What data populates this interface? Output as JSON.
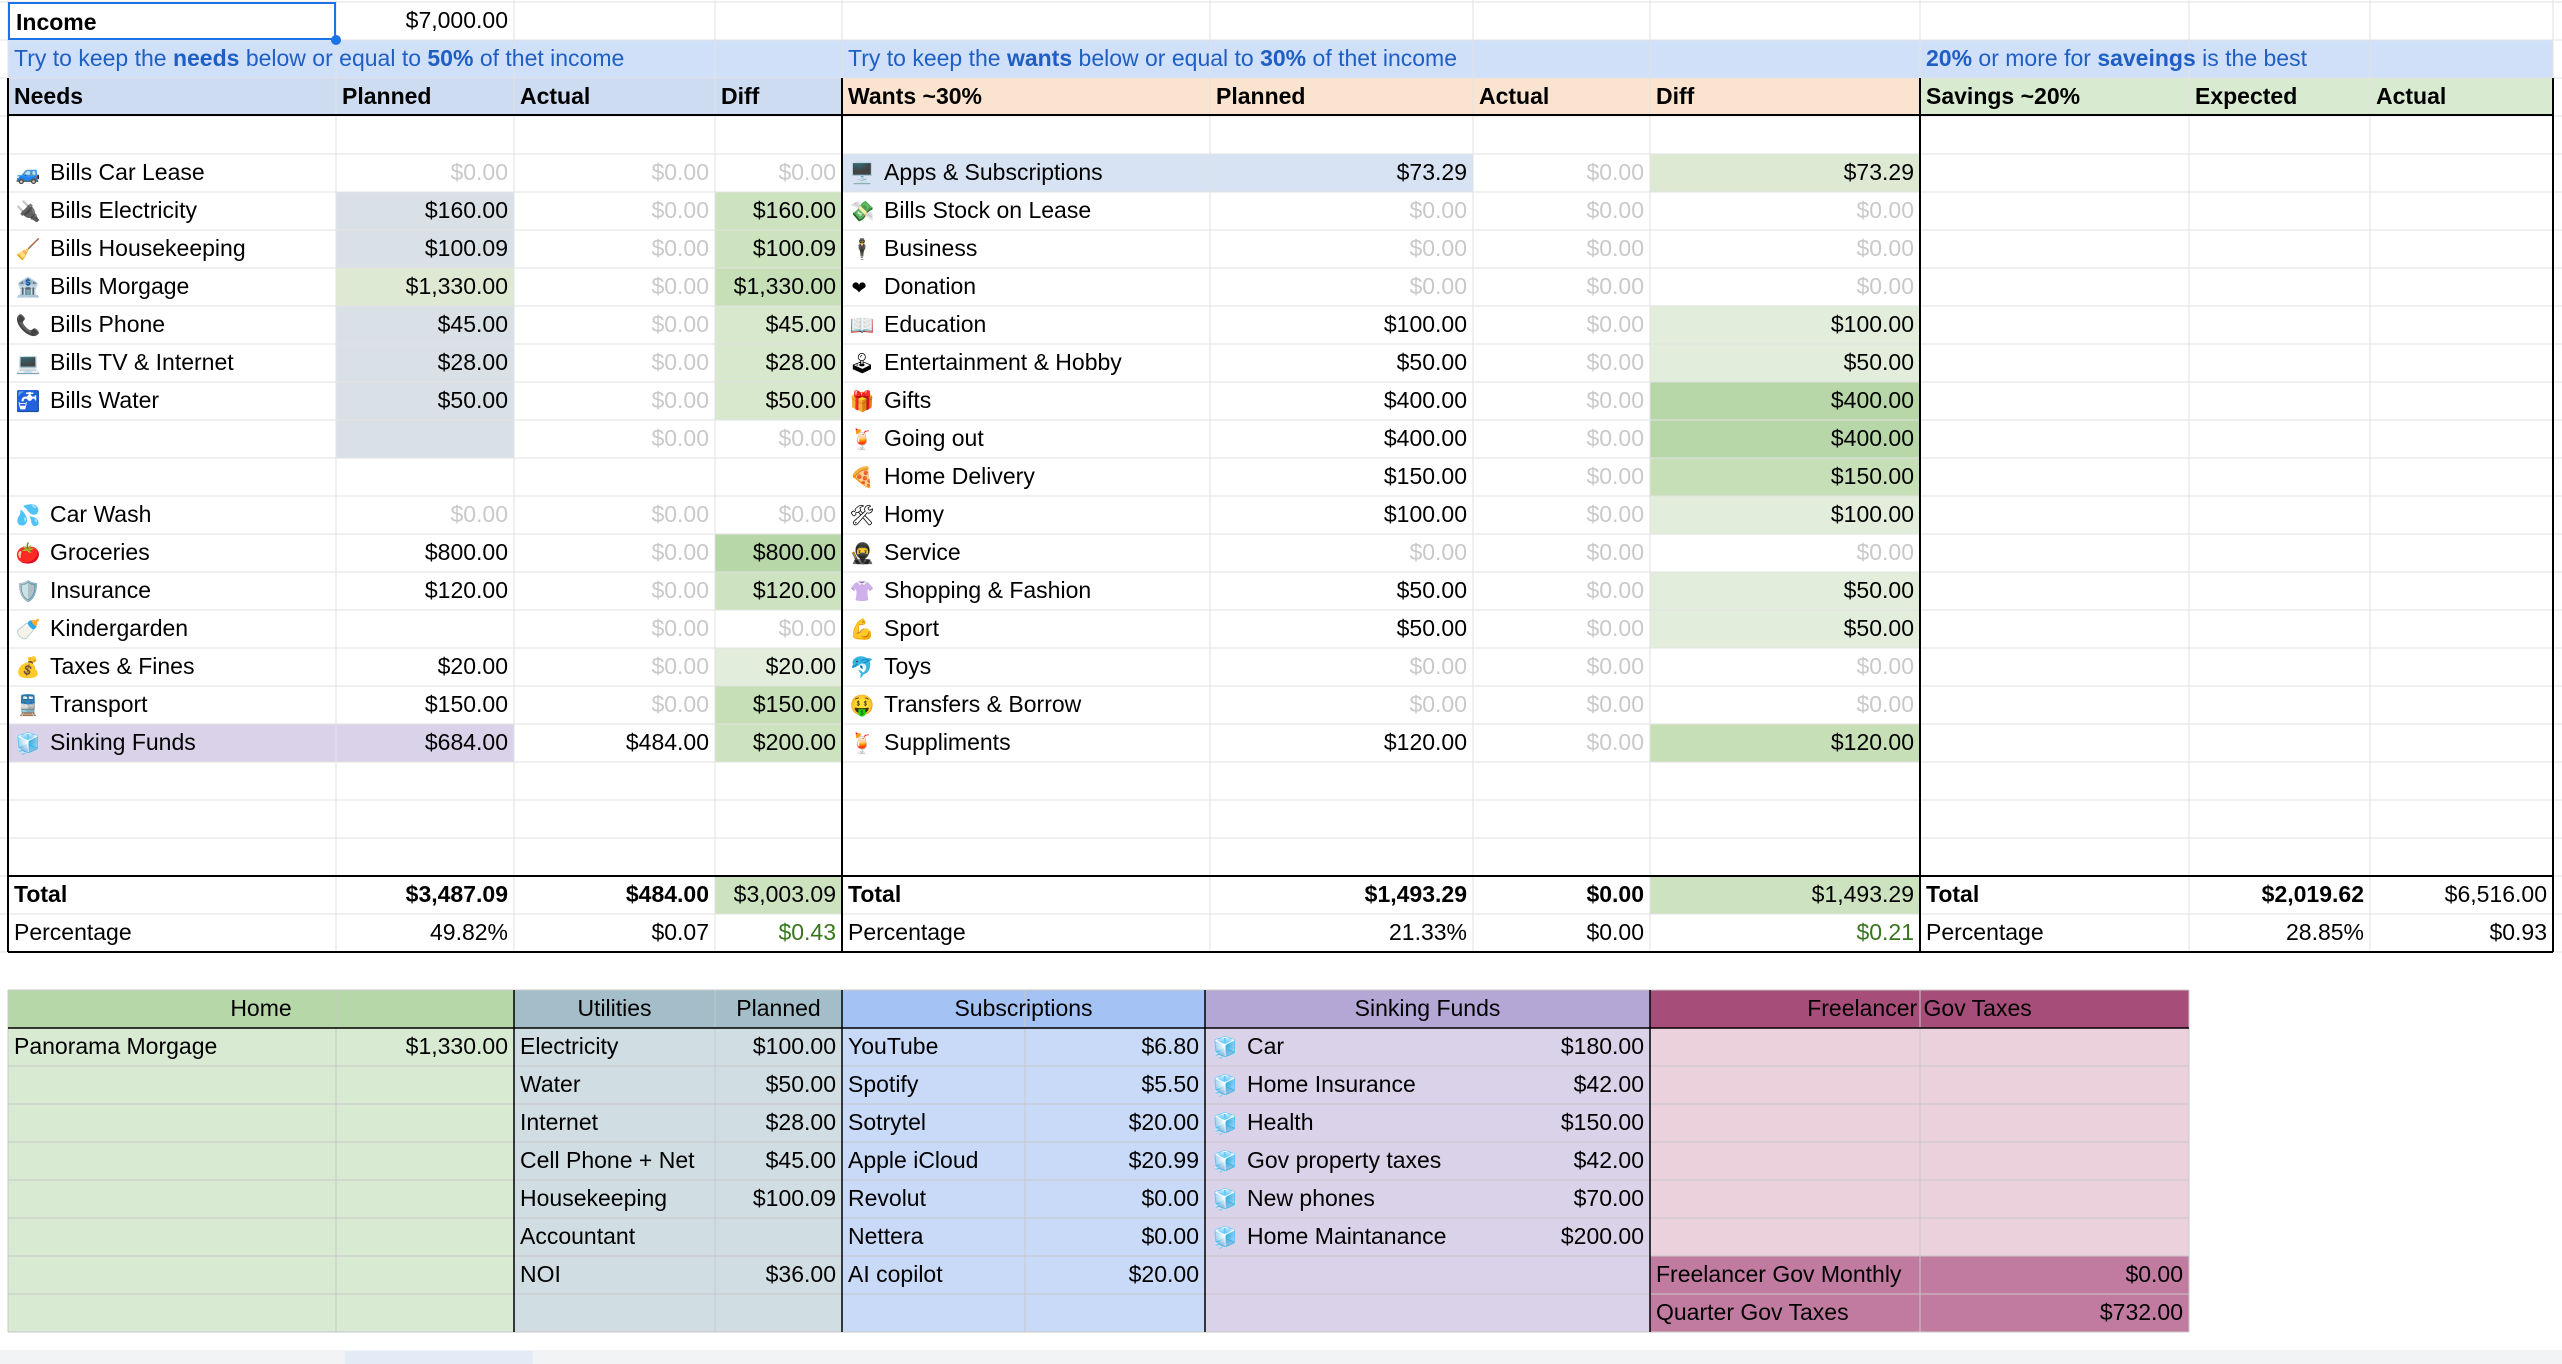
{
  "income": {
    "label": "Income",
    "value": "$7,000.00"
  },
  "notes": [
    {
      "parts": [
        [
          "Try to keep the ",
          0
        ],
        [
          "needs",
          1
        ],
        [
          " below or equal to ",
          0
        ],
        [
          "50%",
          1
        ],
        [
          " of thet income",
          0
        ]
      ]
    },
    {
      "parts": [
        [
          "Try to keep the ",
          0
        ],
        [
          "wants",
          1
        ],
        [
          " below or equal to ",
          0
        ],
        [
          "30%",
          1
        ],
        [
          " of thet income",
          0
        ]
      ]
    },
    {
      "parts": [
        [
          "20%",
          1
        ],
        [
          " or more for ",
          0
        ],
        [
          "saveings",
          1
        ],
        [
          " is the best",
          0
        ]
      ]
    }
  ],
  "headers": {
    "needs": [
      "Needs",
      "Planned",
      "Actual",
      "Diff"
    ],
    "wants": [
      "Wants ~30%",
      "Planned",
      "Actual",
      "Diff"
    ],
    "savings": [
      "Savings ~20%",
      "Expected",
      "Actual"
    ]
  },
  "needs": [
    {
      "icon": "🚙",
      "icon_name": "car-icon",
      "name": "Bills Car Lease",
      "planned": "$0.00",
      "actual": "$0.00",
      "diff": "$0.00",
      "pg": 1,
      "dg": 1,
      "pbg": "",
      "dbg": ""
    },
    {
      "icon": "🔌",
      "icon_name": "plug-icon",
      "name": "Bills Electricity",
      "planned": "$160.00",
      "actual": "$0.00",
      "diff": "$160.00",
      "pg": 0,
      "dg": 0,
      "pbg": "#d9e1e6",
      "dbg": "#cde3c0"
    },
    {
      "icon": "🧹",
      "icon_name": "broom-icon",
      "name": "Bills Housekeeping",
      "planned": "$100.09",
      "actual": "$0.00",
      "diff": "$100.09",
      "pg": 0,
      "dg": 0,
      "pbg": "#d9e1e6",
      "dbg": "#cde3c0"
    },
    {
      "icon": "🏦",
      "icon_name": "bank-icon",
      "name": "Bills Morgage",
      "planned": "$1,330.00",
      "actual": "$0.00",
      "diff": "$1,330.00",
      "pg": 0,
      "dg": 0,
      "pbg": "#dde9d3",
      "dbg": "#c7dfb6"
    },
    {
      "icon": "📞",
      "icon_name": "phone-icon",
      "name": "Bills Phone",
      "planned": "$45.00",
      "actual": "$0.00",
      "diff": "$45.00",
      "pg": 0,
      "dg": 0,
      "pbg": "#d9e1e6",
      "dbg": "#d8e8cd"
    },
    {
      "icon": "💻",
      "icon_name": "laptop-icon",
      "name": "Bills TV & Internet",
      "planned": "$28.00",
      "actual": "$0.00",
      "diff": "$28.00",
      "pg": 0,
      "dg": 0,
      "pbg": "#d9e1e6",
      "dbg": "#d8e8cd"
    },
    {
      "icon": "🚰",
      "icon_name": "water-tap-icon",
      "name": "Bills Water",
      "planned": "$50.00",
      "actual": "$0.00",
      "diff": "$50.00",
      "pg": 0,
      "dg": 0,
      "pbg": "#d9e1e6",
      "dbg": "#d8e8cd"
    },
    {
      "icon": "",
      "icon_name": "",
      "name": "",
      "planned": "",
      "actual": "$0.00",
      "diff": "$0.00",
      "pg": 0,
      "dg": 1,
      "pbg": "#d9e1e6",
      "dbg": ""
    },
    {
      "icon": "",
      "icon_name": "",
      "name": "",
      "planned": "",
      "actual": "",
      "diff": "",
      "pg": 0,
      "dg": 0,
      "pbg": "",
      "dbg": ""
    },
    {
      "icon": "💦",
      "icon_name": "water-drops-icon",
      "name": "Car Wash",
      "planned": "$0.00",
      "actual": "$0.00",
      "diff": "$0.00",
      "pg": 1,
      "dg": 1,
      "pbg": "",
      "dbg": ""
    },
    {
      "icon": "🍅",
      "icon_name": "tomato-icon",
      "name": "Groceries",
      "planned": "$800.00",
      "actual": "$0.00",
      "diff": "$800.00",
      "pg": 0,
      "dg": 0,
      "pbg": "",
      "dbg": "#b7d7a8"
    },
    {
      "icon": "🛡️",
      "icon_name": "shield-icon",
      "name": "Insurance",
      "planned": "$120.00",
      "actual": "$0.00",
      "diff": "$120.00",
      "pg": 0,
      "dg": 0,
      "pbg": "",
      "dbg": "#cde3c0"
    },
    {
      "icon": "🍼",
      "icon_name": "baby-bottle-icon",
      "name": "Kindergarden",
      "planned": "",
      "actual": "$0.00",
      "diff": "$0.00",
      "pg": 0,
      "dg": 1,
      "pbg": "",
      "dbg": ""
    },
    {
      "icon": "💰",
      "icon_name": "money-bag-icon",
      "name": "Taxes & Fines",
      "planned": "$20.00",
      "actual": "$0.00",
      "diff": "$20.00",
      "pg": 0,
      "dg": 0,
      "pbg": "",
      "dbg": "#e2eedb"
    },
    {
      "icon": "🚆",
      "icon_name": "train-icon",
      "name": "Transport",
      "planned": "$150.00",
      "actual": "$0.00",
      "diff": "$150.00",
      "pg": 0,
      "dg": 0,
      "pbg": "",
      "dbg": "#c7dfb6"
    },
    {
      "icon": "🧊",
      "icon_name": "ice-cube-icon",
      "name": "Sinking Funds",
      "planned": "$684.00",
      "actual": "$484.00",
      "diff": "$200.00",
      "pg": 0,
      "dg": 0,
      "pbg": "#d9d2e9",
      "dbg": "#cde3c0",
      "nbg": "#d9d2e9"
    }
  ],
  "wants": [
    {
      "icon": "🖥️",
      "icon_name": "desktop-computer-icon",
      "name": "Apps & Subscriptions",
      "planned": "$73.29",
      "actual": "$0.00",
      "diff": "$73.29",
      "pg": 0,
      "dg": 0,
      "nbg": "#d7e3f2",
      "pbg": "#d7e3f2",
      "dbg": "#dde9d3"
    },
    {
      "icon": "💸",
      "icon_name": "money-wings-icon",
      "name": "Bills Stock on Lease",
      "planned": "$0.00",
      "actual": "$0.00",
      "diff": "$0.00",
      "pg": 1,
      "dg": 1,
      "nbg": "",
      "pbg": "",
      "dbg": ""
    },
    {
      "icon": "🕴",
      "icon_name": "business-person-icon",
      "name": "Business",
      "planned": "$0.00",
      "actual": "$0.00",
      "diff": "$0.00",
      "pg": 1,
      "dg": 1,
      "nbg": "",
      "pbg": "",
      "dbg": ""
    },
    {
      "icon": "❤",
      "icon_name": "heart-icon",
      "name": "Donation",
      "planned": "$0.00",
      "actual": "$0.00",
      "diff": "$0.00",
      "pg": 1,
      "dg": 1,
      "nbg": "",
      "pbg": "",
      "dbg": "",
      "sm": 1
    },
    {
      "icon": "📖",
      "icon_name": "book-icon",
      "name": "Education",
      "planned": "$100.00",
      "actual": "$0.00",
      "diff": "$100.00",
      "pg": 0,
      "dg": 0,
      "nbg": "",
      "pbg": "",
      "dbg": "#e2eedb"
    },
    {
      "icon": "🕹",
      "icon_name": "joystick-icon",
      "name": "Entertainment & Hobby",
      "planned": "$50.00",
      "actual": "$0.00",
      "diff": "$50.00",
      "pg": 0,
      "dg": 0,
      "nbg": "",
      "pbg": "",
      "dbg": "#e2eedb"
    },
    {
      "icon": "🎁",
      "icon_name": "gift-icon",
      "name": "Gifts",
      "planned": "$400.00",
      "actual": "$0.00",
      "diff": "$400.00",
      "pg": 0,
      "dg": 0,
      "nbg": "",
      "pbg": "",
      "dbg": "#b7d7a8"
    },
    {
      "icon": "🍹",
      "icon_name": "drink-icon",
      "name": "Going out",
      "planned": "$400.00",
      "actual": "$0.00",
      "diff": "$400.00",
      "pg": 0,
      "dg": 0,
      "nbg": "",
      "pbg": "",
      "dbg": "#b7d7a8"
    },
    {
      "icon": "🍕",
      "icon_name": "pizza-icon",
      "name": "Home Delivery",
      "planned": "$150.00",
      "actual": "$0.00",
      "diff": "$150.00",
      "pg": 0,
      "dg": 0,
      "nbg": "",
      "pbg": "",
      "dbg": "#c7dfb6"
    },
    {
      "icon": "🛠",
      "icon_name": "tools-icon",
      "name": "Homy",
      "planned": "$100.00",
      "actual": "$0.00",
      "diff": "$100.00",
      "pg": 0,
      "dg": 0,
      "nbg": "",
      "pbg": "",
      "dbg": "#e2eedb"
    },
    {
      "icon": "🥷",
      "icon_name": "ninja-icon",
      "name": "Service",
      "planned": "$0.00",
      "actual": "$0.00",
      "diff": "$0.00",
      "pg": 1,
      "dg": 1,
      "nbg": "",
      "pbg": "",
      "dbg": ""
    },
    {
      "icon": "👚",
      "icon_name": "blouse-icon",
      "name": "Shopping & Fashion",
      "planned": "$50.00",
      "actual": "$0.00",
      "diff": "$50.00",
      "pg": 0,
      "dg": 0,
      "nbg": "",
      "pbg": "",
      "dbg": "#e2eedb"
    },
    {
      "icon": "💪",
      "icon_name": "flexed-biceps-icon",
      "name": "Sport",
      "planned": "$50.00",
      "actual": "$0.00",
      "diff": "$50.00",
      "pg": 0,
      "dg": 0,
      "nbg": "",
      "pbg": "",
      "dbg": "#e2eedb"
    },
    {
      "icon": "🐬",
      "icon_name": "dolphin-icon",
      "name": "Toys",
      "planned": "$0.00",
      "actual": "$0.00",
      "diff": "$0.00",
      "pg": 1,
      "dg": 1,
      "nbg": "",
      "pbg": "",
      "dbg": ""
    },
    {
      "icon": "🤑",
      "icon_name": "money-face-icon",
      "name": "Transfers & Borrow",
      "planned": "$0.00",
      "actual": "$0.00",
      "diff": "$0.00",
      "pg": 1,
      "dg": 1,
      "nbg": "",
      "pbg": "",
      "dbg": ""
    },
    {
      "icon": "🍹",
      "icon_name": "drink-icon",
      "name": "Suppliments",
      "planned": "$120.00",
      "actual": "$0.00",
      "diff": "$120.00",
      "pg": 0,
      "dg": 0,
      "nbg": "",
      "pbg": "",
      "dbg": "#c7dfb6"
    }
  ],
  "totals": {
    "needs": {
      "label": "Total",
      "planned": "$3,487.09",
      "actual": "$484.00",
      "diff": "$3,003.09"
    },
    "wants": {
      "label": "Total",
      "planned": "$1,493.29",
      "actual": "$0.00",
      "diff": "$1,493.29"
    },
    "savings": {
      "label": "Total",
      "expected": "$2,019.62",
      "actual": "$6,516.00"
    }
  },
  "percent": {
    "needs": {
      "label": "Percentage",
      "planned": "49.82%",
      "actual": "$0.07",
      "diff": "$0.43"
    },
    "wants": {
      "label": "Percentage",
      "planned": "21.33%",
      "actual": "$0.00",
      "diff": "$0.21"
    },
    "savings": {
      "label": "Percentage",
      "expected": "28.85%",
      "actual": "$0.93"
    }
  },
  "bottom": {
    "home": {
      "title": "Home",
      "rows": [
        [
          "Panorama Morgage",
          "$1,330.00"
        ]
      ]
    },
    "utilities": {
      "title": "Utilities",
      "planned_label": "Planned",
      "rows": [
        [
          "Electricity",
          "$100.00"
        ],
        [
          "Water",
          "$50.00"
        ],
        [
          "Internet",
          "$28.00"
        ],
        [
          "Cell Phone + Net",
          "$45.00"
        ],
        [
          "Housekeeping",
          "$100.09"
        ],
        [
          "Accountant",
          ""
        ],
        [
          "NOI",
          "$36.00"
        ]
      ]
    },
    "subscriptions": {
      "title": "Subscriptions",
      "rows": [
        [
          "YouTube",
          "$6.80"
        ],
        [
          "Spotify",
          "$5.50"
        ],
        [
          "Sotrytel",
          "$20.00"
        ],
        [
          "Apple iCloud",
          "$20.99"
        ],
        [
          "Revolut",
          "$0.00"
        ],
        [
          "Nettera",
          "$0.00"
        ],
        [
          "AI copilot",
          "$20.00"
        ]
      ]
    },
    "sinking": {
      "title": "Sinking Funds",
      "icon": "🧊",
      "rows": [
        [
          "Car",
          "$180.00"
        ],
        [
          "Home Insurance",
          "$42.00"
        ],
        [
          "Health",
          "$150.00"
        ],
        [
          "Gov property taxes",
          "$42.00"
        ],
        [
          "New phones",
          "$70.00"
        ],
        [
          "Home Maintanance",
          "$200.00"
        ]
      ]
    },
    "freelancer": {
      "title": "Freelancer Gov Taxes",
      "rows": [
        [
          "Freelancer Gov Monthly",
          "$0.00"
        ],
        [
          "Quarter Gov Taxes",
          "$732.00"
        ]
      ]
    }
  },
  "colors": {
    "note_bg": "#cfe0f8",
    "note_text": "#1f5fc4",
    "needs_header": "#cddcf0",
    "wants_header": "#fbe4cf",
    "savings_header": "#d8ebd0",
    "total_diff_green": "#cde3c0",
    "percent_green": "#38761d",
    "home": "#b6d7a8",
    "home_body": "#d9ead3",
    "utilities": "#a3bec8",
    "utilities_body": "#d0dde3",
    "subscriptions": "#a4c2f4",
    "subscriptions_body": "#c9daf8",
    "sinking": "#b4a7d6",
    "sinking_body": "#d9d2e9",
    "freelancer": "#a64d79",
    "freelancer_body": "#ead1dc",
    "freelancer_rows": "#c27ba0"
  }
}
